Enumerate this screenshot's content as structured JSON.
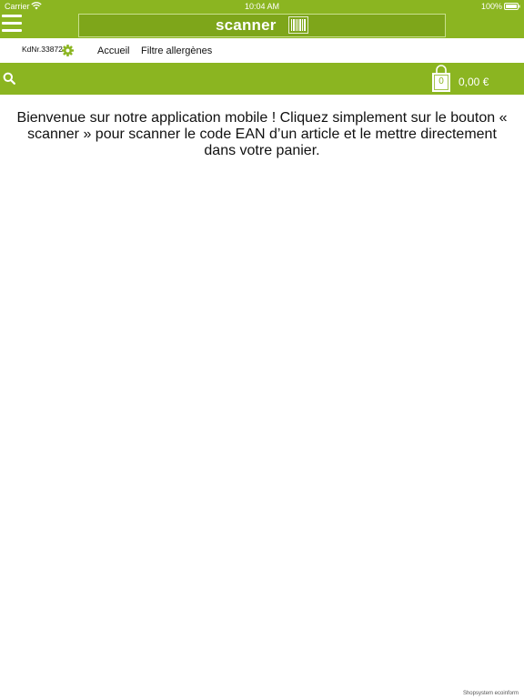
{
  "status_bar": {
    "carrier": "Carrier",
    "time": "10:04 AM",
    "battery": "100%"
  },
  "header": {
    "scanner_label": "scanner"
  },
  "nav": {
    "customer_number": "KdNr.33872",
    "items": [
      "Accueil",
      "Filtre allergènes"
    ]
  },
  "cart": {
    "count": "0",
    "total": "0,00 €"
  },
  "main": {
    "welcome_text": "Bienvenue sur notre application mobile ! Cliquez simplement sur le bouton « scanner » pour scanner le code EAN d’un article et le mettre directement dans votre panier."
  },
  "footer": {
    "credit": "Shopsystem ecoinform"
  },
  "colors": {
    "accent": "#8bb521",
    "scanner_fill": "#7ea61a",
    "text": "#111111"
  },
  "icons": [
    "wifi-icon",
    "battery-icon",
    "menu-icon",
    "barcode-icon",
    "gear-icon",
    "search-icon",
    "shopping-bag-icon"
  ]
}
